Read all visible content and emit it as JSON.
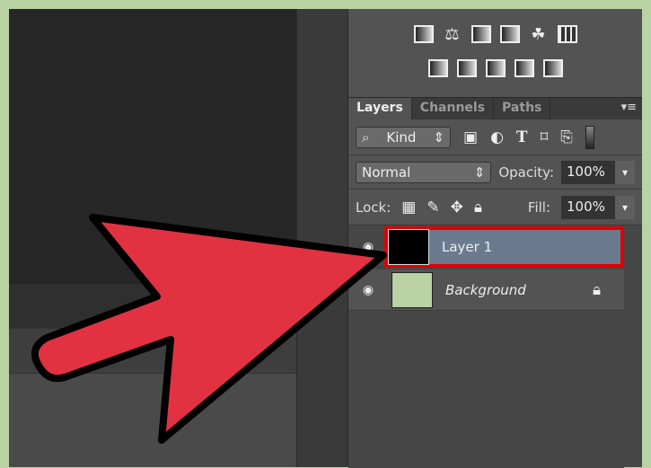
{
  "panel_tabs": [
    {
      "label": "Layers",
      "active": true
    },
    {
      "label": "Channels",
      "active": false
    },
    {
      "label": "Paths",
      "active": false
    }
  ],
  "panel_menu_icon": "panel-menu-icon",
  "filter": {
    "label": "Kind",
    "icon": "search-icon",
    "filter_icons": [
      "image-icon",
      "adjustment-icon",
      "type-icon",
      "shape-icon",
      "smart-object-icon"
    ]
  },
  "blend": {
    "mode": "Normal",
    "opacity_label": "Opacity:",
    "opacity": "100%"
  },
  "lock": {
    "label": "Lock:",
    "fill_label": "Fill:",
    "fill": "100%"
  },
  "layers": [
    {
      "name": "Layer 1",
      "selected": true,
      "thumb_color": "#000000",
      "locked": false
    },
    {
      "name": "Background",
      "selected": false,
      "thumb_color": "#b9d3a5",
      "locked": true
    }
  ],
  "colors": {
    "arrow": "#e23242",
    "highlight": "#e00000",
    "selected_row": "#6a7b8f",
    "frame": "#b9d3a5"
  }
}
